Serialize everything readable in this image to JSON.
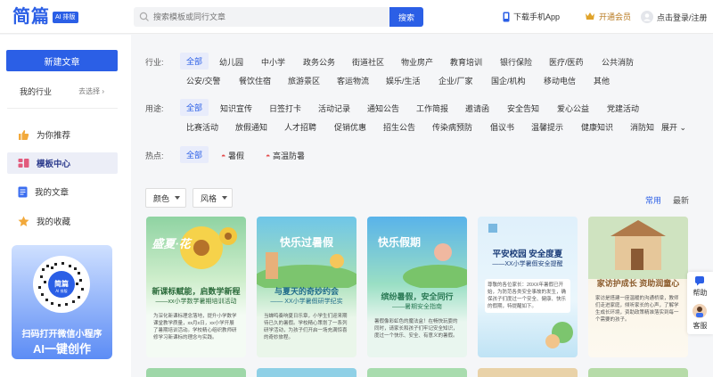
{
  "header": {
    "logo": "简篇",
    "logo_badge": "AI 排版",
    "search_placeholder": "搜索模板或同行文章",
    "search_button": "搜索",
    "download_app": "下载手机App",
    "vip": "开通会员",
    "login": "点击登录/注册"
  },
  "sidebar": {
    "new_article": "新建文章",
    "my_industry": "我的行业",
    "choose": "去选择",
    "nav": [
      {
        "label": "为你推荐",
        "icon": "thumbs-up-icon"
      },
      {
        "label": "模板中心",
        "icon": "template-icon"
      },
      {
        "label": "我的文章",
        "icon": "document-icon"
      },
      {
        "label": "我的收藏",
        "icon": "star-icon"
      }
    ],
    "promo_line1": "扫码打开微信小程序",
    "promo_line2": "AI一键创作"
  },
  "filters": {
    "industry_label": "行业:",
    "industry_row1": [
      "全部",
      "幼儿园",
      "中小学",
      "政务公务",
      "街道社区",
      "物业房产",
      "教育培训",
      "银行保险",
      "医疗/医药",
      "公共消防"
    ],
    "industry_row2": [
      "公安/交警",
      "餐饮住宿",
      "旅游景区",
      "客运物流",
      "娱乐/生活",
      "企业/厂家",
      "国企/机构",
      "移动电信",
      "其他"
    ],
    "usage_label": "用途:",
    "usage_row1": [
      "全部",
      "知识宣传",
      "日签打卡",
      "活动记录",
      "通知公告",
      "工作简报",
      "邀请函",
      "安全告知",
      "爱心公益",
      "党建活动"
    ],
    "usage_row2": [
      "比赛活动",
      "放假通知",
      "人才招聘",
      "促销优惠",
      "招生公告",
      "传染病预防",
      "倡议书",
      "温馨提示",
      "健康知识",
      "消防知"
    ],
    "expand": "展开",
    "hot_label": "热点:",
    "hot": [
      "全部",
      "暑假",
      "高温防暑"
    ]
  },
  "toolbar": {
    "color": "颜色",
    "style": "风格",
    "sort_common": "常用",
    "sort_latest": "最新"
  },
  "cards": [
    {
      "head": "盛夏·花",
      "title": "新课标赋能，启数学新程",
      "sub": "——xx小学数学暑期培训活动",
      "body": "为深化新课标理念落地，提升小学数学课堂教学质量，xx月x日，xx小学开展了暑期培训活动。学校精心组织教师研修学习新课标的理念与实践。"
    },
    {
      "head": "快乐过暑假",
      "title": "与夏天的奇妙约会",
      "sub": "—— XX小学暑假研学纪实",
      "body": "当蝉鸣奏响夏日乐章，小学生们迎来期待已久的暑假。学校精心策划了一系列研学活动，为孩子们开启一场充满惊喜的奇妙旅程。"
    },
    {
      "head": "快乐假期",
      "title": "缤纷暑假，安全同行",
      "sub": "——暑期安全指南",
      "body": "暑假像彩虹色的魔法盒！在畅快玩耍的同时，请家长和孩子们牢记安全知识，度过一个快乐、安全、有意义的暑假。"
    },
    {
      "head": "平安校园 安全度夏",
      "title": "",
      "sub": "——XX小学暑假安全提醒",
      "body": "尊敬的各位家长：20XX年暑假已开始，为防范各类安全事故的发生，确保孩子们度过一个安全、健康、快乐的假期，特提醒如下。"
    },
    {
      "head": "",
      "title": "家访护成长 资助润童心",
      "sub": "",
      "body": "家访是搭建一座温暖的沟通桥梁，教师们走进家庭，倾听家长的心声，了解学生成长环境，资助政策精准落实到每一个需要的孩子。"
    }
  ],
  "float": {
    "help": "帮助",
    "service": "客服"
  },
  "colors": {
    "accent": "#2b5fe6"
  }
}
